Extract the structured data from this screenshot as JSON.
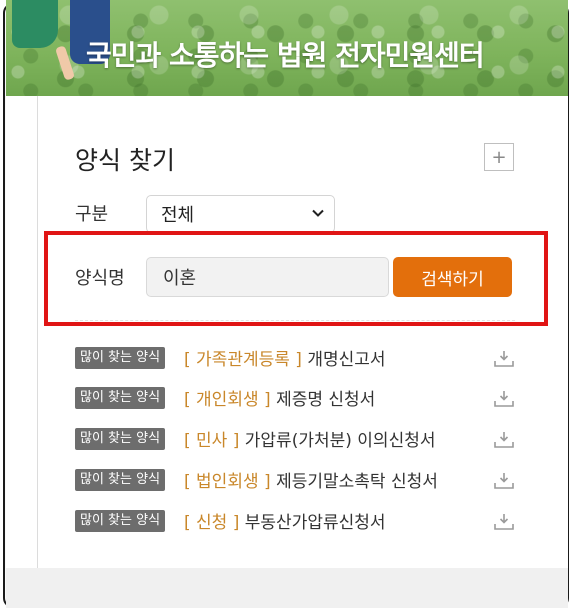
{
  "banner": {
    "title": "국민과 소통하는 법원 전자민원센터"
  },
  "panel": {
    "title": "양식 찾기",
    "expand_symbol": "+",
    "category_label": "구분",
    "category_value": "전체",
    "form_name_label": "양식명",
    "search_value": "이혼",
    "search_button": "검색하기"
  },
  "popular": {
    "badge": "많이 찾는 양식",
    "items": [
      {
        "category": "가족관계등록",
        "name": "개명신고서"
      },
      {
        "category": "개인회생",
        "name": "제증명 신청서"
      },
      {
        "category": "민사",
        "name": "가압류(가처분) 이의신청서"
      },
      {
        "category": "법인회생",
        "name": "제등기말소촉탁 신청서"
      },
      {
        "category": "신청",
        "name": "부동산가압류신청서"
      }
    ]
  },
  "colors": {
    "accent": "#e36f0c",
    "highlight": "#e01515",
    "category": "#c9872a",
    "badge": "#6d6d6d"
  },
  "icons": {
    "expand": "plus-icon",
    "select": "chevron-down-icon",
    "download": "download-icon"
  }
}
